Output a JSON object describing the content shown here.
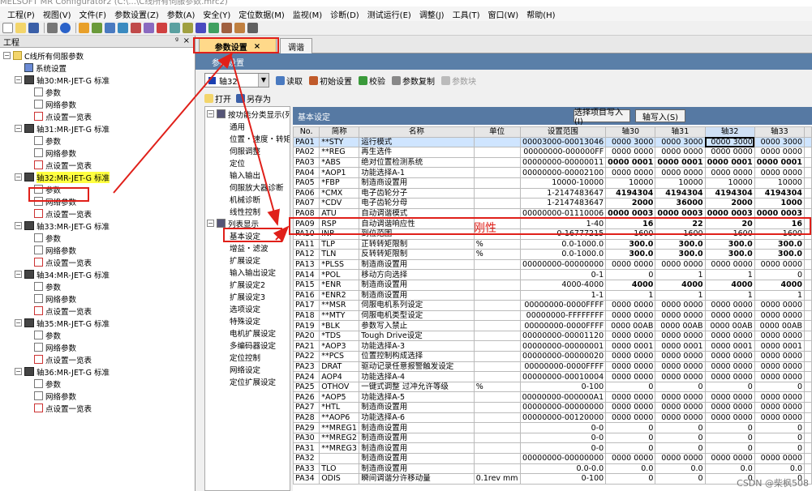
{
  "titlebar": {
    "text": "MELSOFT MR Configurator2 (C:\\...\\C线所有伺服参数.mrc2)"
  },
  "menu": [
    "工程(P)",
    "视图(V)",
    "文件(F)",
    "参数设置(Z)",
    "参数(A)",
    "安全(Y)",
    "定位数据(M)",
    "监视(M)",
    "诊断(D)",
    "测试运行(E)",
    "调整(J)",
    "工具(T)",
    "窗口(W)",
    "帮助(H)"
  ],
  "left_panel": {
    "header": "工程",
    "pin": "ᵍ",
    "close": "×",
    "root": "C线所有伺服参数",
    "system": "系统设置",
    "axes": [
      {
        "label": "轴30:MR-JET-G 标准",
        "children": [
          "参数",
          "网络参数",
          "点设置一览表"
        ]
      },
      {
        "label": "轴31:MR-JET-G 标准",
        "children": [
          "参数",
          "网络参数",
          "点设置一览表"
        ]
      },
      {
        "label": "轴32:MR-JET-G 标准",
        "children": [
          "参数",
          "网络参数",
          "点设置一览表"
        ]
      },
      {
        "label": "轴33:MR-JET-G 标准",
        "children": [
          "参数",
          "网络参数",
          "点设置一览表"
        ]
      },
      {
        "label": "轴34:MR-JET-G 标准",
        "children": [
          "参数",
          "网络参数",
          "点设置一览表"
        ]
      },
      {
        "label": "轴35:MR-JET-G 标准",
        "children": [
          "参数",
          "网络参数",
          "点设置一览表"
        ]
      },
      {
        "label": "轴36:MR-JET-G 标准",
        "children": [
          "参数",
          "网络参数",
          "点设置一览表"
        ]
      }
    ]
  },
  "tabs": [
    {
      "label": "参数设置",
      "close": "×"
    },
    {
      "label": "调谐"
    }
  ],
  "panel_title": "参数设置",
  "axis_select": "轴32",
  "toolbar": {
    "read": "读取",
    "init": "初始设置",
    "verify": "校验",
    "copy": "参数复制",
    "block": "参数块",
    "open": "打开",
    "saveas": "另存为"
  },
  "category": {
    "func_group": "按功能分类显示(列",
    "func_items": [
      "通用",
      "位置・速度・转矩",
      "伺服调整",
      "定位",
      "输入输出",
      "伺服放大器诊断",
      "机械诊断",
      "线性控制"
    ],
    "list_group": "列表显示",
    "list_items": [
      "基本设定",
      "增益・滤波",
      "扩展设定",
      "输入输出设定",
      "扩展设定2",
      "扩展设定3",
      "选项设定",
      "特殊设定",
      "电机扩展设定",
      "多编码器设定",
      "定位控制",
      "网络设定",
      "定位扩展设定"
    ]
  },
  "grid": {
    "title": "基本设定",
    "btn_write": "选择项目写入(I)",
    "btn_axis": "轴写入(S)",
    "columns": [
      "No.",
      "简称",
      "名称",
      "单位",
      "设置范围",
      "轴30",
      "轴31",
      "轴32",
      "轴33"
    ],
    "rows": [
      [
        "PA01",
        "**STY",
        "运行模式",
        "",
        "00003000-00013046",
        "0000 3000",
        "0000 3000",
        "0000 3000",
        "0000 3000"
      ],
      [
        "PA02",
        "**REG",
        "再生选件",
        "",
        "00000000-000000FF",
        "0000 0000",
        "0000 0000",
        "0000 0000",
        "0000 0000"
      ],
      [
        "PA03",
        "*ABS",
        "绝对位置检测系统",
        "",
        "00000000-00000011",
        "0000 0001",
        "0000 0001",
        "0000 0001",
        "0000 0001"
      ],
      [
        "PA04",
        "*AOP1",
        "功能选择A-1",
        "",
        "00000000-00002100",
        "0000 0000",
        "0000 0000",
        "0000 0000",
        "0000 0000"
      ],
      [
        "PA05",
        "*FBP",
        "制造商设置用",
        "",
        "10000-10000",
        "10000",
        "10000",
        "10000",
        "10000"
      ],
      [
        "PA06",
        "*CMX",
        "电子齿轮分子",
        "",
        "1-2147483647",
        "4194304",
        "4194304",
        "4194304",
        "4194304"
      ],
      [
        "PA07",
        "*CDV",
        "电子齿轮分母",
        "",
        "1-2147483647",
        "2000",
        "36000",
        "2000",
        "1000"
      ],
      [
        "PA08",
        "ATU",
        "自动调谐模式",
        "",
        "00000000-01110006",
        "0000 0003",
        "0000 0003",
        "0000 0003",
        "0000 0003"
      ],
      [
        "PA09",
        "RSP",
        "自动调谐响应性",
        "",
        "1-40",
        "16",
        "22",
        "20",
        "16"
      ],
      [
        "PA10",
        "INP",
        "到位范围",
        "",
        "0-16777215",
        "1600",
        "1600",
        "1600",
        "1600"
      ],
      [
        "PA11",
        "TLP",
        "正转转矩限制",
        "%",
        "0.0-1000.0",
        "300.0",
        "300.0",
        "300.0",
        "300.0"
      ],
      [
        "PA12",
        "TLN",
        "反转转矩限制",
        "%",
        "0.0-1000.0",
        "300.0",
        "300.0",
        "300.0",
        "300.0"
      ],
      [
        "PA13",
        "*PLSS",
        "制造商设置用",
        "",
        "00000000-00000000",
        "0000 0000",
        "0000 0000",
        "0000 0000",
        "0000 0000"
      ],
      [
        "PA14",
        "*POL",
        "移动方向选择",
        "",
        "0-1",
        "0",
        "1",
        "1",
        "0"
      ],
      [
        "PA15",
        "*ENR",
        "制造商设置用",
        "",
        "4000-4000",
        "4000",
        "4000",
        "4000",
        "4000"
      ],
      [
        "PA16",
        "*ENR2",
        "制造商设置用",
        "",
        "1-1",
        "1",
        "1",
        "1",
        "1"
      ],
      [
        "PA17",
        "**MSR",
        "伺服电机系列设定",
        "",
        "00000000-0000FFFF",
        "0000 0000",
        "0000 0000",
        "0000 0000",
        "0000 0000"
      ],
      [
        "PA18",
        "**MTY",
        "伺服电机类型设定",
        "",
        "00000000-FFFFFFFF",
        "0000 0000",
        "0000 0000",
        "0000 0000",
        "0000 0000"
      ],
      [
        "PA19",
        "*BLK",
        "参数写入禁止",
        "",
        "00000000-0000FFFF",
        "0000 00AB",
        "0000 00AB",
        "0000 00AB",
        "0000 00AB"
      ],
      [
        "PA20",
        "*TDS",
        "Tough Drive设定",
        "",
        "00000000-00001120",
        "0000 0000",
        "0000 0000",
        "0000 0000",
        "0000 0000"
      ],
      [
        "PA21",
        "*AOP3",
        "功能选择A-3",
        "",
        "00000000-00000001",
        "0000 0001",
        "0000 0001",
        "0000 0001",
        "0000 0001"
      ],
      [
        "PA22",
        "**PCS",
        "位置控制构成选择",
        "",
        "00000000-00000020",
        "0000 0000",
        "0000 0000",
        "0000 0000",
        "0000 0000"
      ],
      [
        "PA23",
        "DRAT",
        "驱动记录任意报警触发设定",
        "",
        "00000000-0000FFFF",
        "0000 0000",
        "0000 0000",
        "0000 0000",
        "0000 0000"
      ],
      [
        "PA24",
        "AOP4",
        "功能选择A-4",
        "",
        "00000000-00010004",
        "0000 0000",
        "0000 0000",
        "0000 0000",
        "0000 0000"
      ],
      [
        "PA25",
        "OTHOV",
        "一键式调整 过冲允许等级",
        "%",
        "0-100",
        "0",
        "0",
        "0",
        "0"
      ],
      [
        "PA26",
        "*AOP5",
        "功能选择A-5",
        "",
        "00000000-000000A1",
        "0000 0000",
        "0000 0000",
        "0000 0000",
        "0000 0000"
      ],
      [
        "PA27",
        "*HTL",
        "制造商设置用",
        "",
        "00000000-00000000",
        "0000 0000",
        "0000 0000",
        "0000 0000",
        "0000 0000"
      ],
      [
        "PA28",
        "**AOP6",
        "功能选择A-6",
        "",
        "00000000-00120000",
        "0000 0000",
        "0000 0000",
        "0000 0000",
        "0000 0000"
      ],
      [
        "PA29",
        "**MREG1",
        "制造商设置用",
        "",
        "0-0",
        "0",
        "0",
        "0",
        "0"
      ],
      [
        "PA30",
        "**MREG2",
        "制造商设置用",
        "",
        "0-0",
        "0",
        "0",
        "0",
        "0"
      ],
      [
        "PA31",
        "**MREG3",
        "制造商设置用",
        "",
        "0-0",
        "0",
        "0",
        "0",
        "0"
      ],
      [
        "PA32",
        "",
        "制造商设置用",
        "",
        "00000000-00000000",
        "0000 0000",
        "0000 0000",
        "0000 0000",
        "0000 0000"
      ],
      [
        "PA33",
        "TLO",
        "制造商设置用",
        "",
        "0.0-0.0",
        "0.0",
        "0.0",
        "0.0",
        "0.0"
      ],
      [
        "PA34",
        "ODIS",
        "瞬间调谐分许移动量",
        "0.1rev mm",
        "0-100",
        "0",
        "0",
        "0",
        "0"
      ]
    ]
  },
  "annotation": {
    "label": "刚性"
  },
  "watermark": "CSDN @柴枫508",
  "colors": {
    "accent_red": "#e0201a",
    "grid_header": "#5679a3",
    "tab_active": "#ffd98a"
  }
}
